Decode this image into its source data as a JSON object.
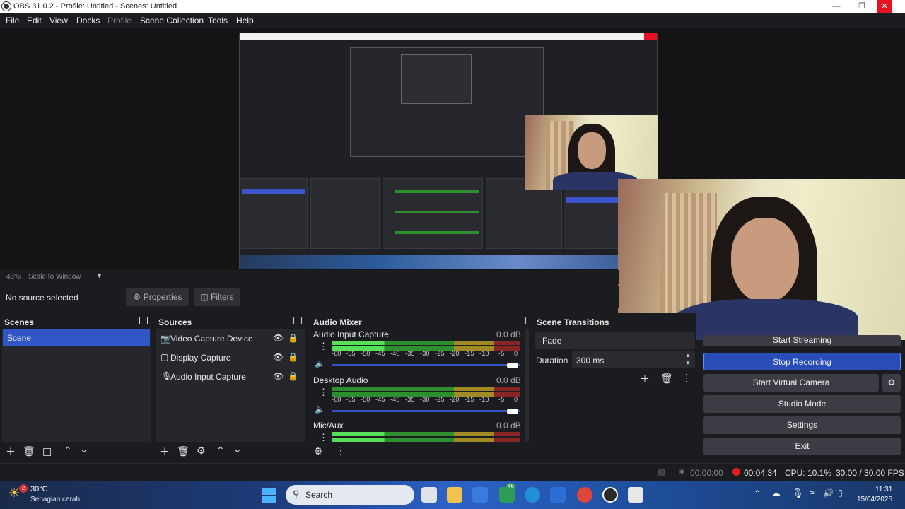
{
  "window": {
    "title": "OBS 31.0.2 - Profile: Untitled - Scenes: Untitled"
  },
  "menu": [
    "File",
    "Edit",
    "View",
    "Docks",
    "Profile",
    "Scene Collection",
    "Tools",
    "Help"
  ],
  "preview": {
    "zoom": "46%",
    "scale_mode": "Scale to Window"
  },
  "source_bar": {
    "status": "No source selected",
    "properties": "Properties",
    "filters": "Filters"
  },
  "scenes": {
    "title": "Scenes",
    "items": [
      "Scene"
    ]
  },
  "sources": {
    "title": "Sources",
    "items": [
      {
        "name": "Video Capture Device",
        "icon": "camera-icon"
      },
      {
        "name": "Display Capture",
        "icon": "monitor-icon"
      },
      {
        "name": "Audio Input Capture",
        "icon": "microphone-icon"
      }
    ]
  },
  "audio_mixer": {
    "title": "Audio Mixer",
    "scale": [
      "-60",
      "-55",
      "-50",
      "-45",
      "-40",
      "-35",
      "-30",
      "-25",
      "-20",
      "-15",
      "-10",
      "-5",
      "0"
    ],
    "channels": [
      {
        "name": "Audio Input Capture",
        "db": "0.0 dB",
        "volume": 1.0
      },
      {
        "name": "Desktop Audio",
        "db": "0.0 dB",
        "volume": 1.0
      },
      {
        "name": "Mic/Aux",
        "db": "0.0 dB",
        "volume": 1.0
      }
    ]
  },
  "transitions": {
    "title": "Scene Transitions",
    "type": "Fade",
    "duration_label": "Duration",
    "duration": "300 ms"
  },
  "controls": {
    "start_streaming": "Start Streaming",
    "stop_recording": "Stop Recording",
    "start_virtual_camera": "Start Virtual Camera",
    "studio_mode": "Studio Mode",
    "settings": "Settings",
    "exit": "Exit"
  },
  "status": {
    "stream_time": "00:00:00",
    "rec_time": "00:04:34",
    "cpu": "CPU: 10.1%",
    "fps": "30.00 / 30.00 FPS"
  },
  "taskbar": {
    "weather_temp": "30°C",
    "weather_desc": "Sebagian cerah",
    "weather_badge": "2",
    "search": "Search",
    "badge_46": "46",
    "time": "11:31",
    "date": "15/04/2025"
  },
  "colors": {
    "accent": "#284cb8",
    "scene_selected": "#2f55c7",
    "rec_dot": "#e02020"
  }
}
